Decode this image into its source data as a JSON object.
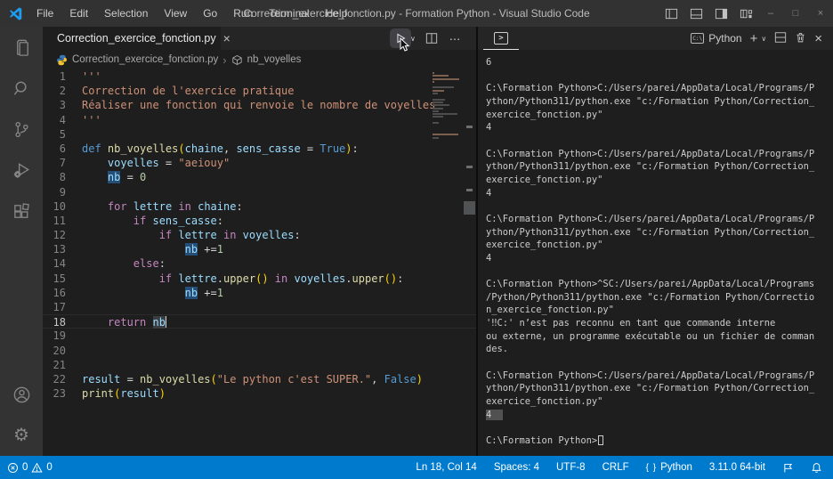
{
  "titlebar": {
    "title": "Correction_exercice_fonction.py - Formation Python - Visual Studio Code",
    "menus": [
      "File",
      "Edit",
      "Selection",
      "View",
      "Go",
      "Run",
      "Terminal",
      "Help"
    ]
  },
  "tab": {
    "label": "Correction_exercice_fonction.py"
  },
  "breadcrumbs": {
    "file": "Correction_exercice_fonction.py",
    "symbol": "nb_voyelles"
  },
  "editor": {
    "cursor_line": 18,
    "lines": [
      {
        "n": 1,
        "tokens": [
          [
            "'''",
            "str"
          ]
        ]
      },
      {
        "n": 2,
        "tokens": [
          [
            "Correction de l'exercice pratique",
            "str"
          ]
        ]
      },
      {
        "n": 3,
        "tokens": [
          [
            "Réaliser une fonction qui renvoie le nombre de voyelles",
            "str"
          ]
        ]
      },
      {
        "n": 4,
        "tokens": [
          [
            "'''",
            "str"
          ]
        ]
      },
      {
        "n": 5,
        "tokens": []
      },
      {
        "n": 6,
        "tokens": [
          [
            "def ",
            "kw"
          ],
          [
            "nb_voyelles",
            "fn"
          ],
          [
            "(",
            "paren"
          ],
          [
            "chaine",
            "var"
          ],
          [
            ", ",
            "op"
          ],
          [
            "sens_casse",
            "var"
          ],
          [
            " = ",
            "op"
          ],
          [
            "True",
            "kw"
          ],
          [
            ")",
            "paren"
          ],
          [
            ":",
            "op"
          ]
        ]
      },
      {
        "n": 7,
        "tokens": [
          [
            "    ",
            "op"
          ],
          [
            "voyelles",
            "var"
          ],
          [
            " = ",
            "op"
          ],
          [
            "\"aeiouy\"",
            "str"
          ]
        ]
      },
      {
        "n": 8,
        "tokens": [
          [
            "    ",
            "op"
          ],
          [
            "nb",
            "var hlb"
          ],
          [
            " = ",
            "op"
          ],
          [
            "0",
            "num"
          ]
        ]
      },
      {
        "n": 9,
        "tokens": []
      },
      {
        "n": 10,
        "tokens": [
          [
            "    ",
            "op"
          ],
          [
            "for",
            "ctrl"
          ],
          [
            " ",
            "op"
          ],
          [
            "lettre",
            "var"
          ],
          [
            " ",
            "op"
          ],
          [
            "in",
            "ctrl"
          ],
          [
            " ",
            "op"
          ],
          [
            "chaine",
            "var"
          ],
          [
            ":",
            "op"
          ]
        ]
      },
      {
        "n": 11,
        "tokens": [
          [
            "        ",
            "op"
          ],
          [
            "if",
            "ctrl"
          ],
          [
            " ",
            "op"
          ],
          [
            "sens_casse",
            "var"
          ],
          [
            ":",
            "op"
          ]
        ]
      },
      {
        "n": 12,
        "tokens": [
          [
            "            ",
            "op"
          ],
          [
            "if",
            "ctrl"
          ],
          [
            " ",
            "op"
          ],
          [
            "lettre",
            "var"
          ],
          [
            " ",
            "op"
          ],
          [
            "in",
            "ctrl"
          ],
          [
            " ",
            "op"
          ],
          [
            "voyelles",
            "var"
          ],
          [
            ":",
            "op"
          ]
        ]
      },
      {
        "n": 13,
        "tokens": [
          [
            "                ",
            "op"
          ],
          [
            "nb",
            "var hlb"
          ],
          [
            " +=",
            "op"
          ],
          [
            "1",
            "num"
          ]
        ]
      },
      {
        "n": 14,
        "tokens": [
          [
            "        ",
            "op"
          ],
          [
            "else",
            "ctrl"
          ],
          [
            ":",
            "op"
          ]
        ]
      },
      {
        "n": 15,
        "tokens": [
          [
            "            ",
            "op"
          ],
          [
            "if",
            "ctrl"
          ],
          [
            " ",
            "op"
          ],
          [
            "lettre",
            "var"
          ],
          [
            ".",
            "op"
          ],
          [
            "upper",
            "fn"
          ],
          [
            "()",
            "paren"
          ],
          [
            " ",
            "op"
          ],
          [
            "in",
            "ctrl"
          ],
          [
            " ",
            "op"
          ],
          [
            "voyelles",
            "var"
          ],
          [
            ".",
            "op"
          ],
          [
            "upper",
            "fn"
          ],
          [
            "()",
            "paren"
          ],
          [
            ":",
            "op"
          ]
        ]
      },
      {
        "n": 16,
        "tokens": [
          [
            "                ",
            "op"
          ],
          [
            "nb",
            "var hlb"
          ],
          [
            " +=",
            "op"
          ],
          [
            "1",
            "num"
          ]
        ]
      },
      {
        "n": 17,
        "tokens": []
      },
      {
        "n": 18,
        "tokens": [
          [
            "    ",
            "op"
          ],
          [
            "return",
            "ctrl"
          ],
          [
            " ",
            "op"
          ],
          [
            "nb",
            "var hlg"
          ]
        ]
      },
      {
        "n": 19,
        "tokens": []
      },
      {
        "n": 20,
        "tokens": []
      },
      {
        "n": 21,
        "tokens": []
      },
      {
        "n": 22,
        "tokens": [
          [
            "result",
            "var"
          ],
          [
            " = ",
            "op"
          ],
          [
            "nb_voyelles",
            "fn"
          ],
          [
            "(",
            "paren"
          ],
          [
            "\"Le python c'est SUPER.\"",
            "str"
          ],
          [
            ", ",
            "op"
          ],
          [
            "False",
            "kw"
          ],
          [
            ")",
            "paren"
          ]
        ]
      },
      {
        "n": 23,
        "tokens": [
          [
            "print",
            "fn"
          ],
          [
            "(",
            "paren"
          ],
          [
            "result",
            "var"
          ],
          [
            ")",
            "paren"
          ]
        ]
      }
    ]
  },
  "panel": {
    "terminal_label": "Python"
  },
  "terminal": {
    "lines": [
      {
        "t": "6"
      },
      {
        "t": ""
      },
      {
        "t": "C:\\Formation Python>C:/Users/parei/AppData/Local/Programs/P"
      },
      {
        "t": "ython/Python311/python.exe \"c:/Formation Python/Correction_"
      },
      {
        "t": "exercice_fonction.py\""
      },
      {
        "t": "4"
      },
      {
        "t": ""
      },
      {
        "t": "C:\\Formation Python>C:/Users/parei/AppData/Local/Programs/P"
      },
      {
        "t": "ython/Python311/python.exe \"c:/Formation Python/Correction_"
      },
      {
        "t": "exercice_fonction.py\""
      },
      {
        "t": "4"
      },
      {
        "t": ""
      },
      {
        "t": "C:\\Formation Python>C:/Users/parei/AppData/Local/Programs/P"
      },
      {
        "t": "ython/Python311/python.exe \"c:/Formation Python/Correction_"
      },
      {
        "t": "exercice_fonction.py\""
      },
      {
        "t": "4"
      },
      {
        "t": ""
      },
      {
        "t": "C:\\Formation Python>^SC:/Users/parei/AppData/Local/Programs"
      },
      {
        "t": "/Python/Python311/python.exe \"c:/Formation Python/Correctio"
      },
      {
        "t": "n_exercice_fonction.py\""
      },
      {
        "t": "'‼C:' n’est pas reconnu en tant que commande interne"
      },
      {
        "t": "ou externe, un programme exécutable ou un fichier de comman"
      },
      {
        "t": "des."
      },
      {
        "t": ""
      },
      {
        "t": "C:\\Formation Python>C:/Users/parei/AppData/Local/Programs/P"
      },
      {
        "t": "ython/Python311/python.exe \"c:/Formation Python/Correction_"
      },
      {
        "t": "exercice_fonction.py\""
      },
      {
        "t": "4",
        "sel": true
      },
      {
        "t": ""
      },
      {
        "t": "C:\\Formation Python>",
        "cursor": true
      }
    ]
  },
  "statusbar": {
    "errors": "0",
    "warnings": "0",
    "ln_col": "Ln 18, Col 14",
    "spaces": "Spaces: 4",
    "encoding": "UTF-8",
    "eol": "CRLF",
    "language": "Python",
    "interpreter": "3.11.0 64-bit"
  },
  "icons": {
    "close": "×",
    "minimize": "–",
    "maximize": "□",
    "more": "⋯",
    "plus": "+",
    "chevron_down": "∨",
    "breadcrumb_sep": "›",
    "panel_terminal_glyph": ">",
    "lang_braces": "{ }"
  },
  "colors": {
    "statusbar": "#007acc",
    "titlebar": "#323233",
    "activitybar": "#333333",
    "editor_bg": "#1e1e1e",
    "tabbar_bg": "#252526",
    "string": "#ce9178",
    "keyword": "#569cd6",
    "control": "#c586c0",
    "function": "#dcdcaa",
    "variable": "#9cdcfe",
    "number": "#b5cea8",
    "word_highlight_blue": "#264f78",
    "word_highlight_gray": "#3a3d41"
  }
}
